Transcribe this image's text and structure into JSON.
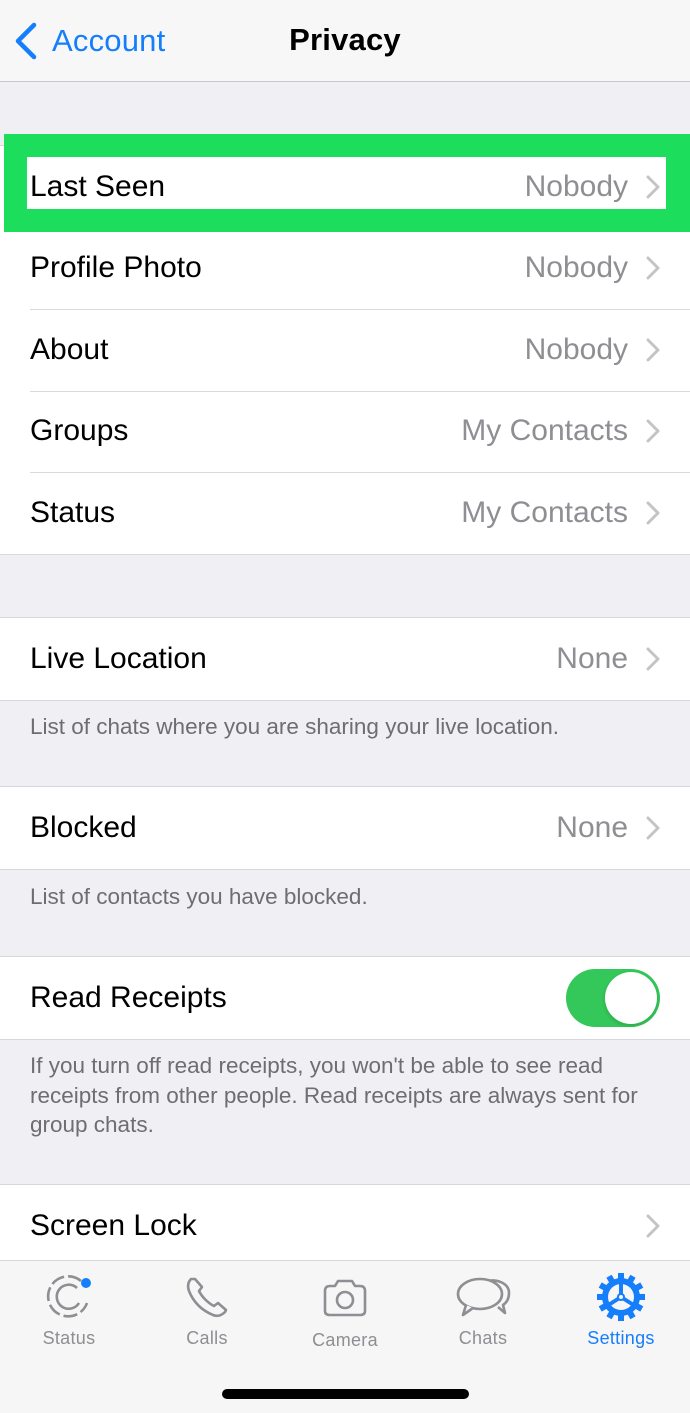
{
  "navbar": {
    "back_label": "Account",
    "title": "Privacy"
  },
  "colors": {
    "accent": "#157efb",
    "toggle_on": "#34c759",
    "highlight": "#1cdd5c"
  },
  "section1": {
    "rows": [
      {
        "label": "Last Seen",
        "value": "Nobody",
        "highlighted": true
      },
      {
        "label": "Profile Photo",
        "value": "Nobody"
      },
      {
        "label": "About",
        "value": "Nobody"
      },
      {
        "label": "Groups",
        "value": "My Contacts"
      },
      {
        "label": "Status",
        "value": "My Contacts"
      }
    ]
  },
  "live_location": {
    "label": "Live Location",
    "value": "None",
    "footer": "List of chats where you are sharing your live location."
  },
  "blocked": {
    "label": "Blocked",
    "value": "None",
    "footer": "List of contacts you have blocked."
  },
  "read_receipts": {
    "label": "Read Receipts",
    "enabled": true,
    "footer": "If you turn off read receipts, you won't be able to see read receipts from other people. Read receipts are always sent for group chats."
  },
  "screen_lock": {
    "label": "Screen Lock"
  },
  "tabbar": {
    "tabs": [
      {
        "label": "Status",
        "icon": "status-icon",
        "badge": true
      },
      {
        "label": "Calls",
        "icon": "phone-icon"
      },
      {
        "label": "Camera",
        "icon": "camera-icon"
      },
      {
        "label": "Chats",
        "icon": "chat-bubbles-icon"
      },
      {
        "label": "Settings",
        "icon": "gear-icon",
        "active": true
      }
    ]
  }
}
